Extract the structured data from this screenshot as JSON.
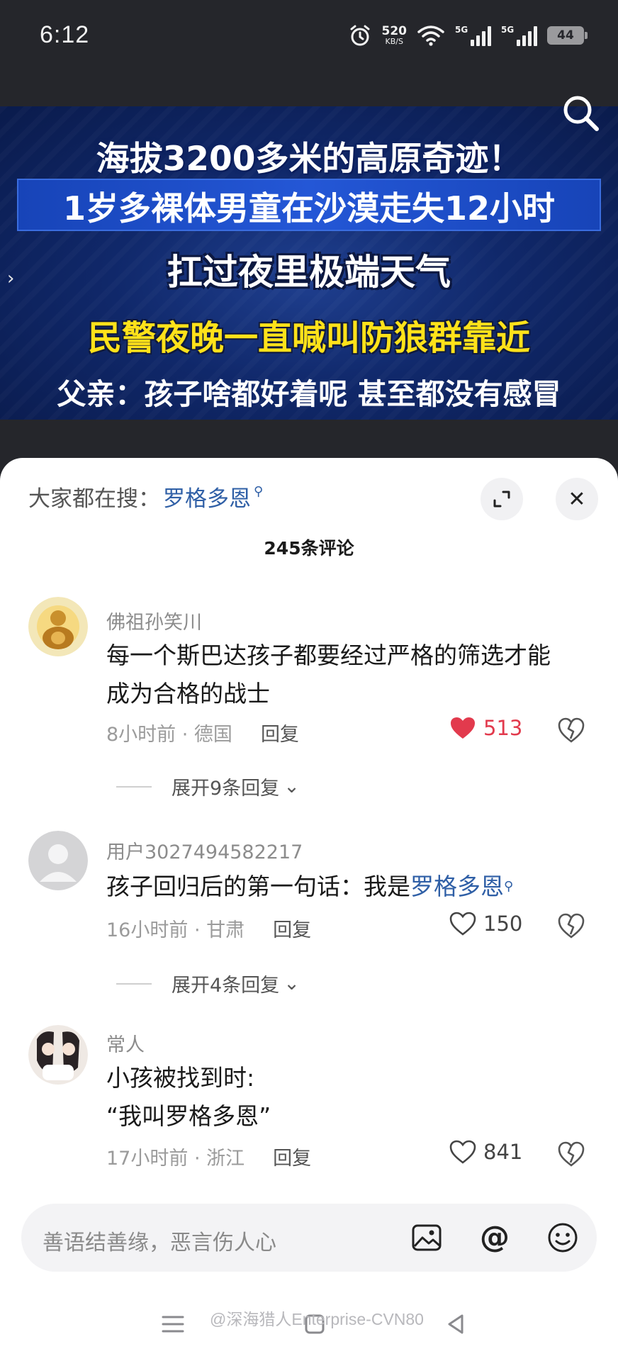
{
  "status_bar": {
    "time": "6:12",
    "net_speed_value": "520",
    "net_speed_unit": "KB/S",
    "sim1_label": "5G",
    "sim2_label": "5G",
    "battery": "44",
    "icons": [
      "alarm-icon",
      "wifi-icon",
      "signal-icon",
      "battery-icon"
    ]
  },
  "video": {
    "headline_1": "海拔3200多米的高原奇迹！",
    "headline_2": "1岁多裸体男童在沙漠走失12小时",
    "headline_3": "扛过夜里极端天气",
    "headline_4": "民警夜晚一直喊叫防狼群靠近",
    "headline_5": "父亲：孩子啥都好着呢 甚至都没有感冒",
    "arrow": "›"
  },
  "comments_panel": {
    "trending_label": "大家都在搜：",
    "trending_keyword": "罗格多恩",
    "close": "✕",
    "count_label": "245条评论",
    "comments": [
      {
        "username": "佛祖孙笑川",
        "text_line1": "每一个斯巴达孩子都要经过严格的筛选才能",
        "text_line2": "成为合格的战士",
        "time_location": "8小时前 · 德国",
        "reply_label": "回复",
        "likes": "513",
        "liked": true,
        "expand_replies": "展开9条回复"
      },
      {
        "username": "用户3027494582217",
        "text_prefix": "孩子回归后的第一句话：我是",
        "text_link": "罗格多恩",
        "time_location": "16小时前 · 甘肃",
        "reply_label": "回复",
        "likes": "150",
        "liked": false,
        "expand_replies": "展开4条回复"
      },
      {
        "username": "常人",
        "text_line1": "小孩被找到时:",
        "text_line2": "“我叫罗格多恩”",
        "time_location": "17小时前 · 浙江",
        "reply_label": "回复",
        "likes": "841",
        "liked": false
      }
    ]
  },
  "input_bar": {
    "placeholder": "善语结善缘，恶言伤人心",
    "at_symbol": "@"
  },
  "watermark": "@深海猎人Enterprise-CVN80",
  "colors": {
    "accent_link": "#2f5fa6",
    "like_red": "#e23a4d",
    "headline_yellow": "#ffe21a",
    "video_blue": "#10286a"
  }
}
